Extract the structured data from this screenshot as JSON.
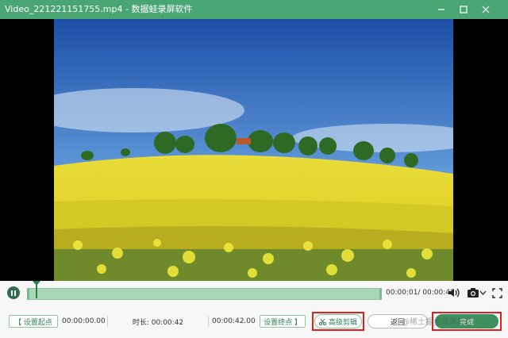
{
  "window": {
    "title": "Video_221221151755.mp4 - 数据蛙录屏软件"
  },
  "player": {
    "current_time": "00:00:01",
    "total_time": "/ 00:00:42",
    "progress": 0.024
  },
  "edit": {
    "set_start_label": "【 设置起点",
    "start_value": "00:00:00.00",
    "duration_label": "时长: 00:00:42",
    "end_value": "00:00:42.00",
    "set_end_label": "设置终点 】",
    "advanced_cut_label": "高级剪辑",
    "back_label": "返回",
    "finish_label": "完成"
  },
  "watermark": "@稀土掘金技术社区",
  "colors": {
    "accent": "#4aa574",
    "highlight": "#e0201a"
  }
}
